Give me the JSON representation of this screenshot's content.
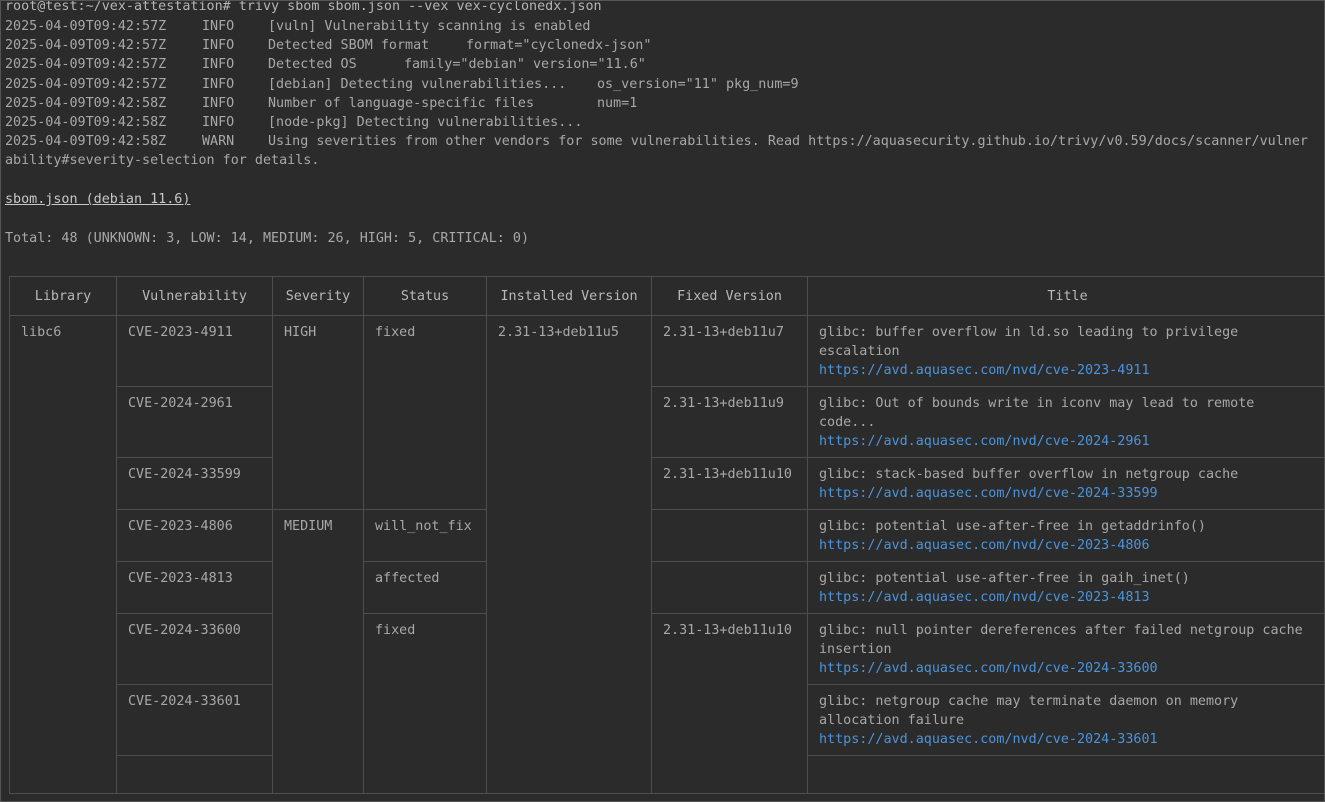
{
  "command_line": "root@test:~/vex-attestation# trivy sbom sbom.json --vex vex-cyclonedx.json",
  "logs": [
    {
      "ts": "2025-04-09T09:42:57Z",
      "level": "INFO",
      "message": "[vuln] Vulnerability scanning is enabled",
      "kv": ""
    },
    {
      "ts": "2025-04-09T09:42:57Z",
      "level": "INFO",
      "message": "Detected SBOM format",
      "kv": "format=\"cyclonedx-json\""
    },
    {
      "ts": "2025-04-09T09:42:57Z",
      "level": "INFO",
      "message": "Detected OS",
      "kv": "family=\"debian\" version=\"11.6\""
    },
    {
      "ts": "2025-04-09T09:42:57Z",
      "level": "INFO",
      "message": "[debian] Detecting vulnerabilities...",
      "kv": "os_version=\"11\" pkg_num=9"
    },
    {
      "ts": "2025-04-09T09:42:58Z",
      "level": "INFO",
      "message": "Number of language-specific files",
      "kv": "num=1"
    },
    {
      "ts": "2025-04-09T09:42:58Z",
      "level": "INFO",
      "message": "[node-pkg] Detecting vulnerabilities...",
      "kv": ""
    },
    {
      "ts": "2025-04-09T09:42:58Z",
      "level": "WARN",
      "message": "Using severities from other vendors for some vulnerabilities. Read https://aquasecurity.github.io/trivy/v0.59/docs/scanner/vulner",
      "kv": ""
    }
  ],
  "log_continuation": "ability#severity-selection for details.",
  "target": "sbom.json (debian 11.6)",
  "total": "Total: 48 (UNKNOWN: 3, LOW: 14, MEDIUM: 26, HIGH: 5, CRITICAL: 0)",
  "table": {
    "headers": {
      "library": "Library",
      "vulnerability": "Vulnerability",
      "severity": "Severity",
      "status": "Status",
      "installed": "Installed Version",
      "fixed": "Fixed Version",
      "title": "Title"
    },
    "library": "libc6",
    "installed": "2.31-13+deb11u5",
    "severity_high": "HIGH",
    "severity_medium": "MEDIUM",
    "colors": {
      "high": "#d9622b",
      "medium": "#d6a01f",
      "link": "#4b94dc"
    },
    "rows": [
      {
        "cve": "CVE-2023-4911",
        "status": "fixed",
        "fixed": "2.31-13+deb11u7",
        "title": "glibc: buffer overflow in ld.so leading to privilege escalation",
        "link": "https://avd.aquasec.com/nvd/cve-2023-4911"
      },
      {
        "cve": "CVE-2024-2961",
        "status": "",
        "fixed": "2.31-13+deb11u9",
        "title": "glibc: Out of bounds write in iconv may lead to remote code...",
        "link": "https://avd.aquasec.com/nvd/cve-2024-2961"
      },
      {
        "cve": "CVE-2024-33599",
        "status": "",
        "fixed": "2.31-13+deb11u10",
        "title": "glibc: stack-based buffer overflow in netgroup cache",
        "link": "https://avd.aquasec.com/nvd/cve-2024-33599"
      },
      {
        "cve": "CVE-2023-4806",
        "status": "will_not_fix",
        "fixed": "",
        "title": "glibc: potential use-after-free in getaddrinfo()",
        "link": "https://avd.aquasec.com/nvd/cve-2023-4806"
      },
      {
        "cve": "CVE-2023-4813",
        "status": "affected",
        "fixed": "",
        "title": "glibc: potential use-after-free in gaih_inet()",
        "link": "https://avd.aquasec.com/nvd/cve-2023-4813"
      },
      {
        "cve": "CVE-2024-33600",
        "status": "fixed",
        "fixed": "2.31-13+deb11u10",
        "title": "glibc: null pointer dereferences after failed netgroup cache insertion",
        "link": "https://avd.aquasec.com/nvd/cve-2024-33600"
      },
      {
        "cve": "CVE-2024-33601",
        "status": "",
        "fixed": "",
        "title": "glibc: netgroup cache may terminate daemon on memory allocation failure",
        "link": "https://avd.aquasec.com/nvd/cve-2024-33601"
      }
    ]
  }
}
